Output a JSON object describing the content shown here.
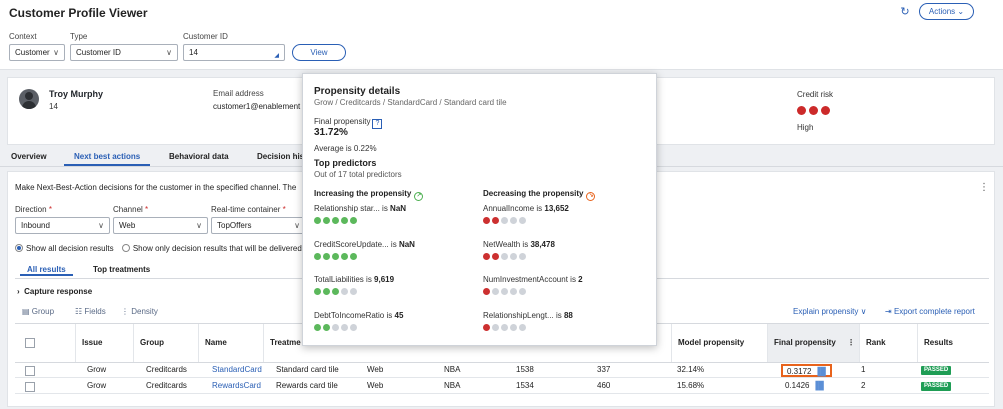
{
  "app": {
    "title": "Customer Profile Viewer",
    "refresh_icon": "refresh-icon",
    "actions_label": "Actions"
  },
  "filters": {
    "context_label": "Context",
    "context_value": "Customer",
    "type_label": "Type",
    "type_value": "Customer ID",
    "customer_id_label": "Customer ID",
    "customer_id_value": "14",
    "view_label": "View"
  },
  "profile": {
    "name": "Troy Murphy",
    "id": "14",
    "email_label": "Email address",
    "email_value": "customer1@enablement",
    "credit_risk_label": "Credit risk",
    "credit_risk_value": "High",
    "credit_dots": 3
  },
  "tabs": [
    "Overview",
    "Next best actions",
    "Behavioral data",
    "Decision his"
  ],
  "nba": {
    "intro": "Make Next-Best-Action decisions for the customer in the specified channel. The",
    "direction_label": "Direction",
    "direction_value": "Inbound",
    "channel_label": "Channel",
    "channel_value": "Web",
    "container_label": "Real-time container",
    "container_value": "TopOffers",
    "radio_all": "Show all decision results",
    "radio_only": "Show only decision results that will be delivered",
    "subtabs": [
      "All results",
      "Top treatments"
    ],
    "capture_label": "Capture response",
    "toolbar": {
      "group": "Group",
      "fields": "Fields",
      "density": "Density"
    },
    "explain_label": "Explain propensity",
    "export_label": "Export complete report"
  },
  "table": {
    "columns": [
      "Issue",
      "Group",
      "Name",
      "Treatme",
      "Model propensity",
      "Final propensity",
      "Rank",
      "Results"
    ],
    "rows": [
      {
        "issue": "Grow",
        "group": "Creditcards",
        "name": "StandardCard",
        "treatment": "Standard card tile",
        "channel": "Web",
        "direction": "NBA",
        "c1": "1538",
        "c2": "337",
        "model": "32.14%",
        "final": "0.3172",
        "rank": "1",
        "result": "PASSED"
      },
      {
        "issue": "Grow",
        "group": "Creditcards",
        "name": "RewardsCard",
        "treatment": "Rewards card tile",
        "channel": "Web",
        "direction": "NBA",
        "c1": "1534",
        "c2": "460",
        "model": "15.68%",
        "final": "0.1426",
        "rank": "2",
        "result": "PASSED"
      }
    ]
  },
  "popover": {
    "title": "Propensity details",
    "path": "Grow / Creditcards / StandardCard / Standard card tile",
    "final_label": "Final propensity",
    "final_value": "31.72%",
    "average": "Average is 0.22%",
    "top_predictors": "Top predictors",
    "top_predictors_sub": "Out of 17 total predictors",
    "increasing_label": "Increasing the propensity",
    "decreasing_label": "Decreasing the propensity",
    "increasing": [
      {
        "name": "Relationship star...",
        "value": "NaN",
        "level": 5
      },
      {
        "name": "CreditScoreUpdate...",
        "value": "NaN",
        "level": 5
      },
      {
        "name": "TotalLiabilities",
        "value": "9,619",
        "level": 3
      },
      {
        "name": "DebtToIncomeRatio",
        "value": "45",
        "level": 2
      }
    ],
    "decreasing": [
      {
        "name": "AnnualIncome",
        "value": "13,652",
        "level": 2
      },
      {
        "name": "NetWealth",
        "value": "38,478",
        "level": 2
      },
      {
        "name": "NumInvestmentAccount",
        "value": "2",
        "level": 1
      },
      {
        "name": "RelationshipLengt...",
        "value": "88",
        "level": 1
      }
    ]
  },
  "colors": {
    "accent": "#2a5fb5",
    "highlight": "#e8631c",
    "passed": "#1f9d55",
    "risk": "#cc2a2a",
    "increase": "#5cb85c"
  }
}
